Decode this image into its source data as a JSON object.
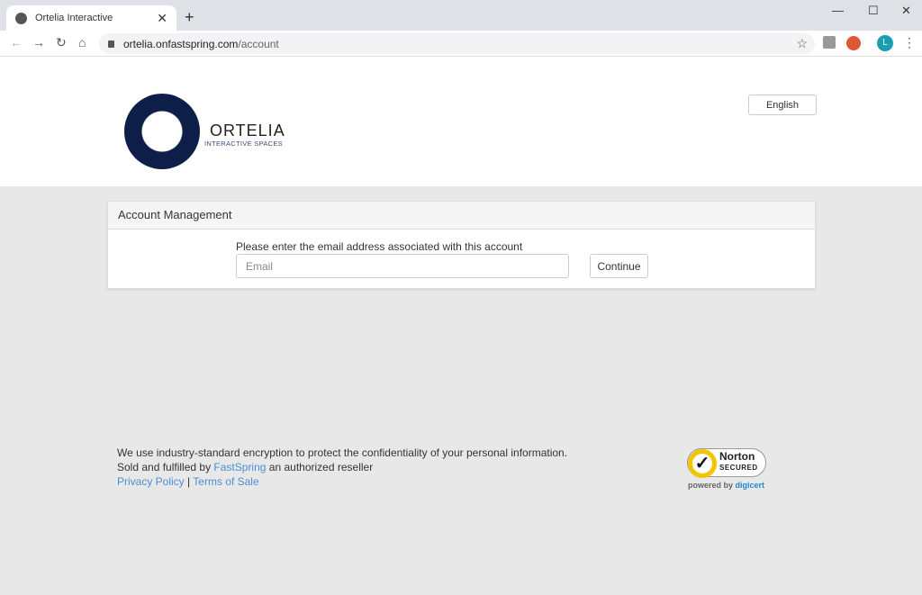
{
  "browser": {
    "tab_title": "Ortelia Interactive",
    "url_host": "ortelia.onfastspring.com",
    "url_path": "/account",
    "profile_initial": "L"
  },
  "header": {
    "logo_name": "ORTELIA",
    "logo_tagline": "INTERACTIVE SPACES",
    "language": "English"
  },
  "panel": {
    "title": "Account Management",
    "prompt": "Please enter the email address associated with this account",
    "email_placeholder": "Email",
    "email_value": "",
    "continue_label": "Continue"
  },
  "footer": {
    "line1": "We use industry-standard encryption to protect the confidentiality of your personal information.",
    "line2_prefix": "Sold and fulfilled by",
    "line2_link": "FastSpring",
    "line2_suffix": "an authorized reseller",
    "privacy": "Privacy Policy",
    "separator": "|",
    "terms": "Terms of Sale"
  },
  "norton": {
    "name": "Norton",
    "secured": "SECURED",
    "powered": "powered by",
    "brand": "digicert"
  }
}
